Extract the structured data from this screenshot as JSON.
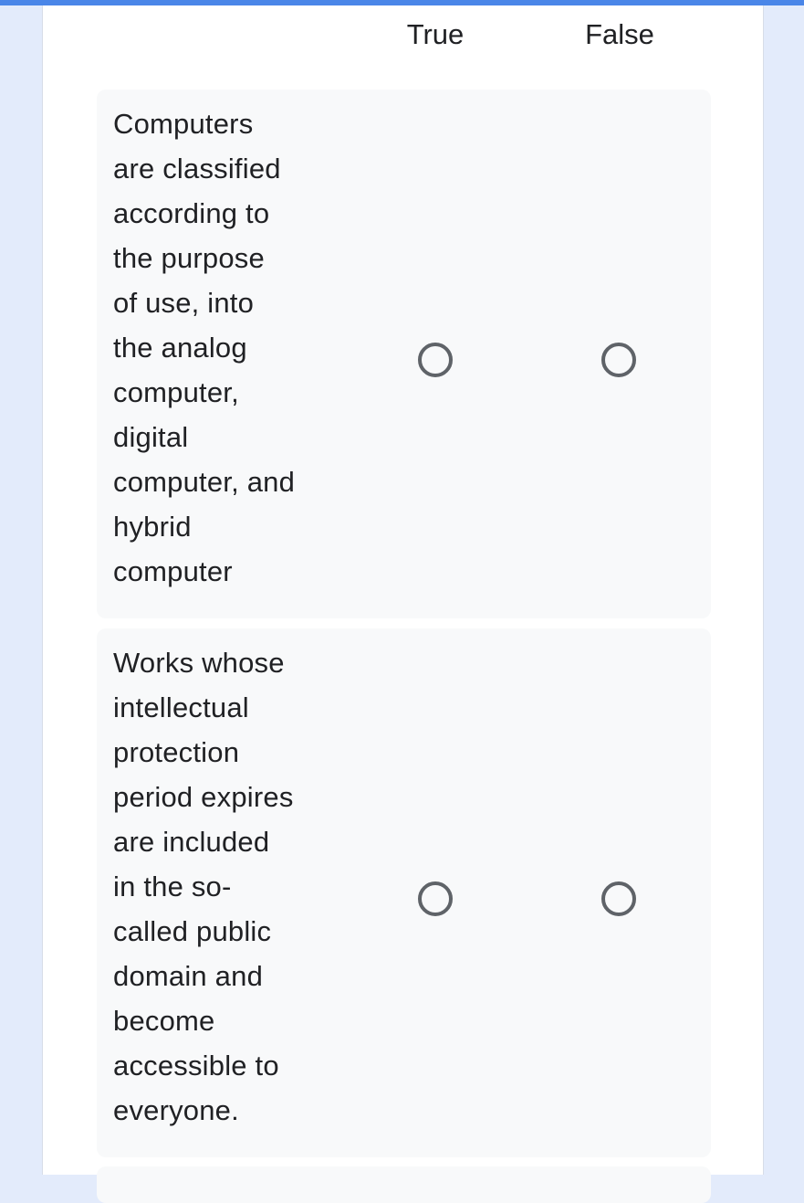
{
  "grid": {
    "columns": [
      "True",
      "False"
    ],
    "rows": [
      {
        "question": "Computers\nare classified\naccording to\nthe purpose\nof use, into\nthe analog\ncomputer,\ndigital\ncomputer, and\nhybrid\ncomputer",
        "selected": null
      },
      {
        "question": "Works whose\nintellectual\nprotection\nperiod expires\nare included\nin the so-\ncalled public\ndomain and\nbecome\naccessible to\neveryone.",
        "selected": null
      }
    ]
  },
  "colors": {
    "accent": "#4a86e8",
    "page_background": "#e3ebfb",
    "row_background": "#f8f9fa",
    "radio_border": "#5f6368"
  }
}
